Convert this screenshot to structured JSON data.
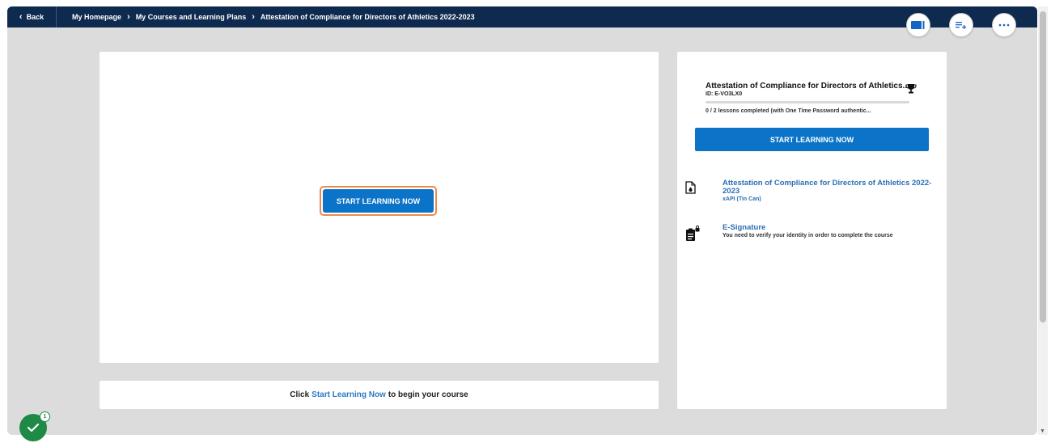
{
  "topbar": {
    "back_label": "Back",
    "breadcrumbs": [
      "My Homepage",
      "My Courses and Learning Plans",
      "Attestation of Compliance for Directors of Athletics 2022-2023"
    ]
  },
  "toolbar": {
    "icons": [
      "video-icon",
      "add-to-list-icon",
      "more-icon"
    ]
  },
  "player": {
    "start_label": "START LEARNING NOW"
  },
  "hint": {
    "prefix": "Click",
    "link": "Start Learning Now",
    "suffix": "to begin your course"
  },
  "course": {
    "title": "Attestation of Compliance for Directors of Athletics...",
    "id": "ID: E-VO3LX0",
    "progress_text": "0 / 2 lessons completed (with One Time Password authentic...",
    "progress_fraction": 0,
    "start_label": "START LEARNING NOW",
    "lessons": [
      {
        "title": "Attestation of Compliance for Directors of Athletics 2022-2023",
        "subtitle": "xAPI (Tin Can)",
        "icon": "document-icon"
      },
      {
        "title": "E-Signature",
        "subtitle": "You need to verify your identity in order to complete the course",
        "icon": "locked-clipboard-icon"
      }
    ]
  },
  "notification": {
    "count": "1",
    "icon": "checkmark-icon"
  },
  "colors": {
    "topbar": "#0f2a4f",
    "primary": "#0b74c8",
    "highlight": "#f08a4b",
    "success": "#1e8a46"
  }
}
